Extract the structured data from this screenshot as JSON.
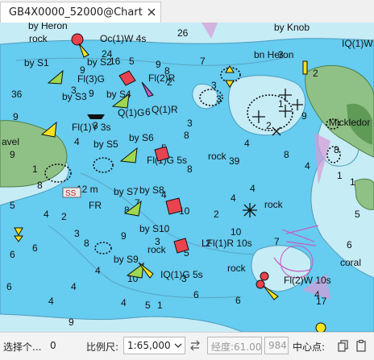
{
  "tab": {
    "title": "GB4X0000_52000@Chart",
    "close_icon": "close-icon"
  },
  "map": {
    "colors": {
      "deep_water": "#66ccf0",
      "shallow_water": "#c6ecf6",
      "land": "#8fc186",
      "land_dark": "#5f9a57",
      "buoy_red": "#e8434f",
      "buoy_green": "#9ed84f",
      "buoy_yellow": "#f6e21e",
      "magenta": "#c85bc0",
      "label": "#111111"
    },
    "depths": [
      "26",
      "24",
      "16",
      "5",
      "9",
      "8",
      "2",
      "7",
      "3",
      "3",
      "9",
      "6",
      "36",
      "1",
      "6",
      "4",
      "8",
      "3",
      "7",
      "8",
      "39",
      "4",
      "8",
      "4",
      "3",
      "6",
      "2",
      "3",
      "2",
      "3",
      "4",
      "9",
      "3",
      "9",
      "4",
      "9",
      "8",
      "5",
      "6",
      "6",
      "3",
      "3",
      "0",
      "1",
      "2",
      "5",
      "4",
      "4",
      "8",
      "6",
      "4",
      "4",
      "1",
      "3",
      "6",
      "6",
      "4",
      "7",
      "10",
      "4",
      "4",
      "2",
      "1",
      "5",
      "6",
      "1",
      "1",
      "2",
      "3",
      "8",
      "4",
      "8",
      "9",
      "2",
      "7",
      "3",
      "9",
      "4",
      "10",
      "5",
      "1",
      "3",
      "5",
      "8",
      "10",
      "4",
      "5",
      "7",
      "1",
      "2",
      "5",
      "3",
      "1",
      "2",
      "3",
      "3",
      "1",
      "15",
      "4",
      "4",
      "3",
      "4",
      "2",
      "2",
      "2",
      "2",
      "4",
      "2",
      "2",
      "2",
      "2",
      "3",
      "9",
      "17",
      "2",
      "4",
      "8",
      "0",
      "2",
      "4",
      "5",
      "1",
      "9",
      "6",
      "1",
      "2",
      "1",
      "3",
      "5",
      "9",
      "8",
      "6"
    ],
    "labels": {
      "heron_top": "by Heron",
      "rock_top": "rock",
      "oc_light": "Oc(1)W 4s",
      "by_knob": "by Knob",
      "iq_w": "IQ(1)W",
      "by_s1": "by S1",
      "by_s2": "by S2",
      "bn_heron": "bn Heron",
      "fl3g": "Fl(3)G",
      "fl2r": "Fl(2)R",
      "by_s3": "by S3",
      "by_s4": "by S4",
      "q1g": "Q(1)G",
      "q1r": "Q(1)R",
      "mickledor": "Mickledor",
      "fl1y": "Fl(1)Y 3s",
      "by_s6": "by S6",
      "by_s5": "by S5",
      "gravel": "avel",
      "rock_mid": "rock",
      "fl1g": "Fl(1)G 5s",
      "twelve_m": "12 m",
      "by_s7": "by S7",
      "by_s8": "by S8",
      "fr": "FR",
      "rock_right": "rock",
      "by_s10": "by S10",
      "rock_low": "rock",
      "lfl1r": "LFl(1)R 10s",
      "by_s9": "by S9",
      "coral": "coral",
      "rock_bottom": "rock",
      "iq1g": "IQ(1)G 5s",
      "fl2w": "Fl(2)W 10s",
      "ss": "SS"
    }
  },
  "statusbar": {
    "select_label": "选择个...",
    "select_count": "0",
    "scale_label": "比例尺:",
    "scale_value": "1:65,000",
    "dropdown_icon": "chevron-down-icon",
    "swap_icon": "swap-icon",
    "longitude_label": "经度:61.00",
    "field_value": "984",
    "center_label": "中心点:",
    "copy_icon": "copy-icon",
    "paste_icon": "paste-icon"
  }
}
